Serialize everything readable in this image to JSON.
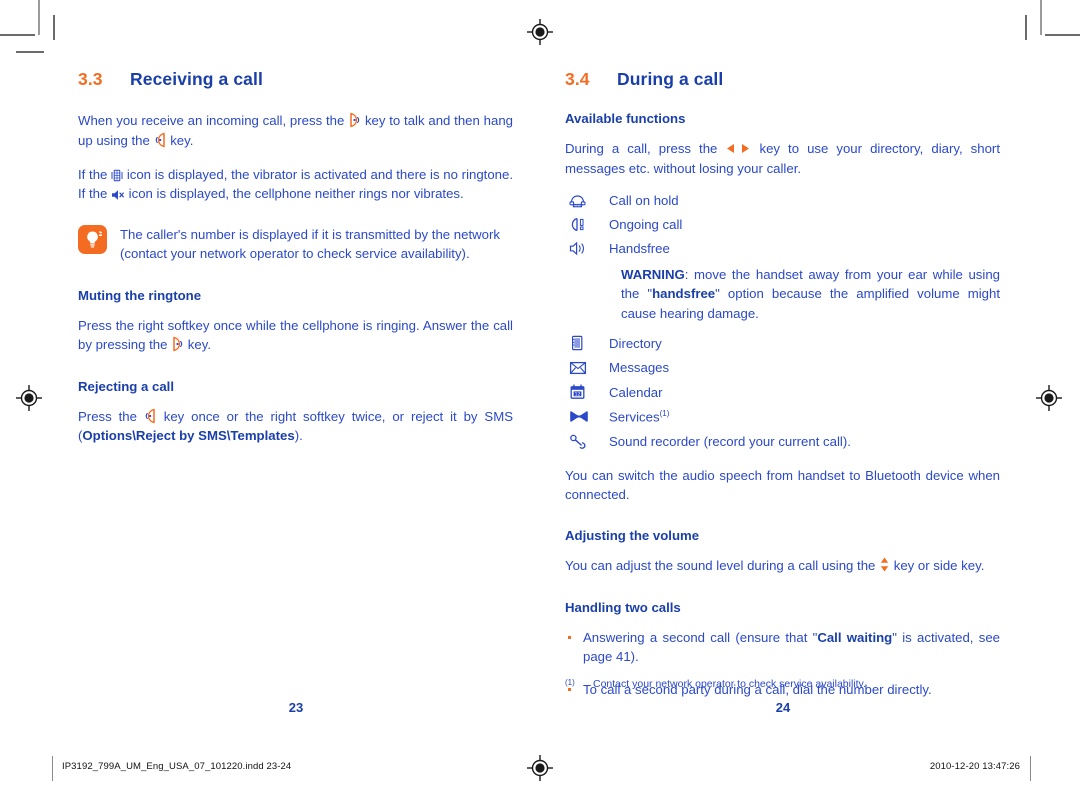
{
  "colors": {
    "heading_blue": "#1a3faa",
    "body_blue": "#2b49c8",
    "accent_orange": "#f36c21"
  },
  "left_column": {
    "section_number": "3.3",
    "section_title": "Receiving a call",
    "paragraph_1_a": "When you receive an incoming call, press the",
    "paragraph_1_b": "key to talk and then hang up using the",
    "paragraph_1_c": "key.",
    "paragraph_2_a": "If the",
    "paragraph_2_b": "icon is displayed, the vibrator is activated and there is no ringtone. If the",
    "paragraph_2_c": "icon is displayed, the cellphone neither rings nor vibrates.",
    "tip_text": "The caller's number is displayed if it is transmitted by the network (contact your network operator to check service availability).",
    "subhead_1": "Muting the ringtone",
    "paragraph_3_a": "Press the right softkey once while the cellphone is ringing. Answer the call by pressing the",
    "paragraph_3_b": "key.",
    "subhead_2": "Rejecting a call",
    "paragraph_4_a": "Press the",
    "paragraph_4_b": "key once or the right softkey twice, or reject it by SMS (",
    "paragraph_4_bold": "Options\\Reject by SMS\\Templates",
    "paragraph_4_c": ").",
    "page_number": "23"
  },
  "right_column": {
    "section_number": "3.4",
    "section_title": "During a call",
    "subhead_1": "Available functions",
    "paragraph_1_a": "During a call, press the",
    "paragraph_1_b": "key to use your directory, diary, short messages etc. without losing your caller.",
    "function_items": [
      {
        "icon": "telephone-handset-icon",
        "label": "Call on hold"
      },
      {
        "icon": "ongoing-call-icon",
        "label": "Ongoing call"
      },
      {
        "icon": "loudspeaker-icon",
        "label": "Handsfree"
      }
    ],
    "warning_label": "WARNING",
    "warning_text_a": ": move the handset away from your ear while using the \"",
    "warning_bold": "handsfree",
    "warning_text_b": "\" option because the amplified volume might cause hearing damage.",
    "function_items_2": [
      {
        "icon": "directory-book-icon",
        "label": "Directory",
        "footnote": ""
      },
      {
        "icon": "envelope-icon",
        "label": "Messages",
        "footnote": ""
      },
      {
        "icon": "calendar-icon",
        "label": "Calendar",
        "footnote": ""
      },
      {
        "icon": "services-bowtie-icon",
        "label": "Services",
        "footnote": "(1)"
      },
      {
        "icon": "sound-recorder-icon",
        "label": "Sound recorder (record your current call).",
        "footnote": ""
      }
    ],
    "paragraph_2": "You can switch the audio speech from handset to Bluetooth device when connected.",
    "subhead_2": "Adjusting the volume",
    "paragraph_3_a": "You can adjust the sound level during a call using the",
    "paragraph_3_b": "key or side key.",
    "subhead_3": "Handling two calls",
    "bullets": [
      {
        "text_a": "Answering a second call (ensure that \"",
        "bold": "Call waiting",
        "text_b": "\" is activated, see page 41)."
      },
      {
        "text_a": "To call a second party during a call, dial the number directly.",
        "bold": "",
        "text_b": ""
      }
    ],
    "footnote_marker": "(1)",
    "footnote_text": "Contact your network operator to check service availability.",
    "page_number": "24"
  },
  "print_footer": {
    "filename": "IP3192_799A_UM_Eng_USA_07_101220.indd   23-24",
    "timestamp": "2010-12-20   13:47:26"
  }
}
